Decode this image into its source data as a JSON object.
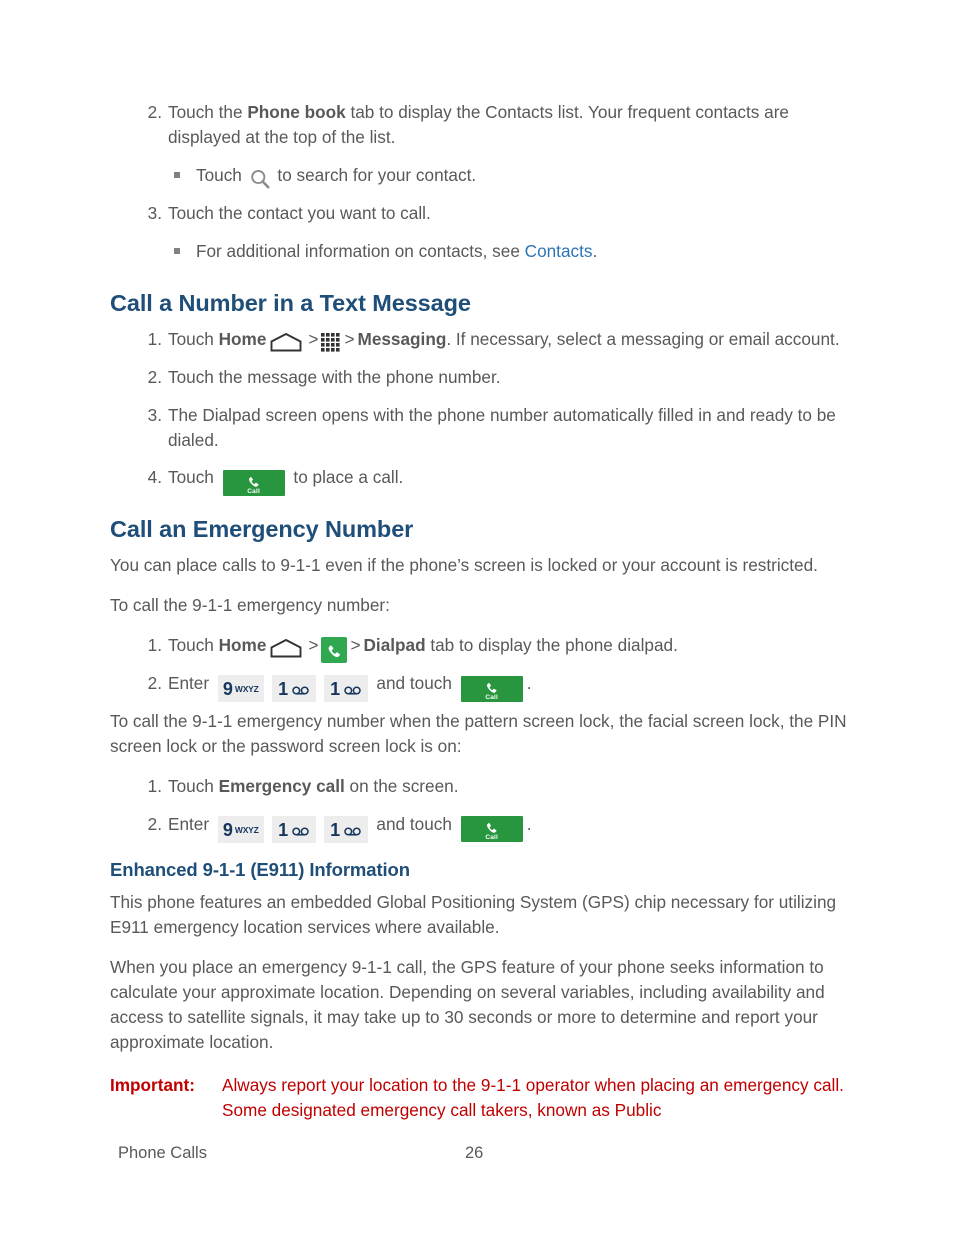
{
  "document": {
    "footer_section": "Phone Calls",
    "page_number": "26"
  },
  "colors": {
    "heading_blue": "#1F4E79",
    "link_blue": "#2E74B5",
    "body_gray": "#595959",
    "important_red": "#C00000",
    "call_button_green": "#27963F",
    "phone_app_green": "#2FA84F",
    "key_gray": "#EDEDED",
    "key_digit_navy": "#16365C"
  },
  "top_list": {
    "items": [
      {
        "num": "2.",
        "parts": [
          {
            "t": "text",
            "v": "Touch the "
          },
          {
            "t": "bold",
            "v": "Phone book"
          },
          {
            "t": "text",
            "v": " tab to display the Contacts list. Your frequent contacts are displayed at the top of the list."
          }
        ]
      },
      {
        "num": "3.",
        "parts": [
          {
            "t": "text",
            "v": "Touch the contact you want to call."
          }
        ]
      }
    ],
    "bullet_search": {
      "before": "Touch ",
      "after": " to search for your contact.",
      "icon": "search-icon"
    },
    "bullet_contacts": {
      "before": "For additional information on contacts, see ",
      "link": "Contacts",
      "after": "."
    }
  },
  "section_text_message": {
    "heading": "Call a Number in a Text Message",
    "steps": [
      {
        "num": "1.",
        "before_home": "Touch ",
        "home_label": "Home",
        "sep1": ">",
        "sep2": ">",
        "bold_target": "Messaging",
        "after": ". If necessary, select a messaging or email account.",
        "icons": [
          "home-icon",
          "apps-grid-icon"
        ]
      },
      {
        "num": "2.",
        "text": "Touch the message with the phone number."
      },
      {
        "num": "3.",
        "text": "The Dialpad screen opens with the phone number automatically filled in and ready to be dialed."
      },
      {
        "num": "4.",
        "before_button": "Touch ",
        "after_button": " to place a call.",
        "button_label": "Call"
      }
    ]
  },
  "section_emergency": {
    "heading": "Call an Emergency Number",
    "intro": "You can place calls to 9-1-1 even if the phone’s screen is locked or your account is restricted.",
    "lead_in": "To call the 9-1-1 emergency number:",
    "steps": [
      {
        "num": "1.",
        "before_home": "Touch ",
        "home_label": "Home",
        "sep1": ">",
        "sep2": ">",
        "bold_target": "Dialpad",
        "after": " tab to display the phone dialpad.",
        "icons": [
          "home-icon",
          "phone-app-icon"
        ]
      },
      {
        "num": "2.",
        "before_keys": "Enter ",
        "keys": [
          {
            "digit": "9",
            "letters": "WXYZ"
          },
          {
            "digit": "1",
            "letters": "voicemail"
          },
          {
            "digit": "1",
            "letters": "voicemail"
          }
        ],
        "mid": " and touch ",
        "button_label": "Call",
        "after": "."
      }
    ],
    "lock_lead_in": "To call the 9-1-1 emergency number when the pattern screen lock, the facial screen lock, the PIN screen lock or the password screen lock is on:",
    "lock_steps": [
      {
        "num": "1.",
        "before": "Touch ",
        "bold": "Emergency call",
        "after": " on the screen."
      },
      {
        "num": "2.",
        "before_keys": "Enter ",
        "keys": [
          {
            "digit": "9",
            "letters": "WXYZ"
          },
          {
            "digit": "1",
            "letters": "voicemail"
          },
          {
            "digit": "1",
            "letters": "voicemail"
          }
        ],
        "mid": " and touch ",
        "button_label": "Call",
        "after": "."
      }
    ]
  },
  "section_e911": {
    "heading": "Enhanced 9-1-1 (E911) Information",
    "paragraph1": "This phone features an embedded Global Positioning System (GPS) chip necessary for utilizing E911 emergency location services where available.",
    "paragraph2": "When you place an emergency 9-1-1 call, the GPS feature of your phone seeks information to calculate your approximate location. Depending on several variables, including availability and access to satellite signals, it may take up to 30 seconds or more to determine and report your approximate location.",
    "important_label": "Important:",
    "important_text": "Always report your location to the 9-1-1 operator when placing an emergency call. Some designated emergency call takers, known as Public"
  }
}
